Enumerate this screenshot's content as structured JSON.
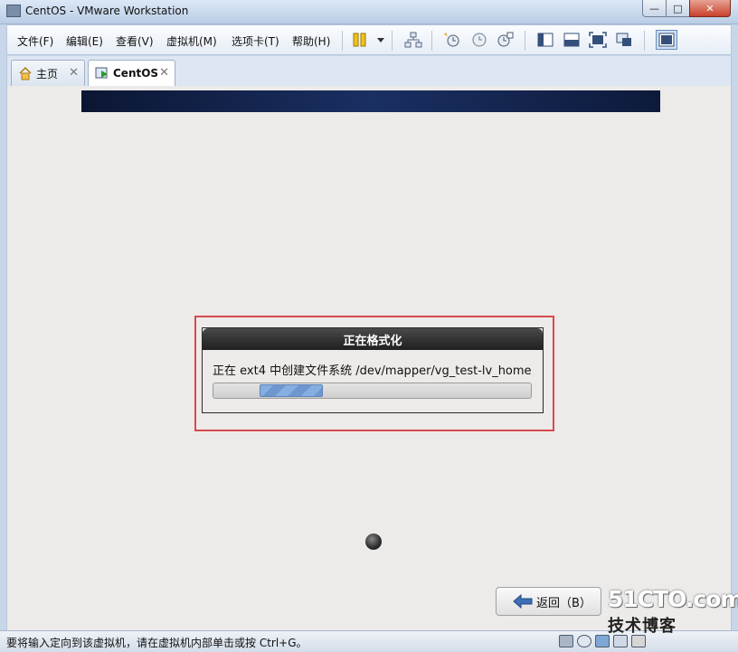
{
  "window": {
    "title": "CentOS - VMware Workstation",
    "minimize_glyph": "—",
    "maximize_glyph": "□",
    "close_glyph": "✕"
  },
  "menu": {
    "items": [
      "文件(F)",
      "编辑(E)",
      "查看(V)",
      "虚拟机(M)",
      "选项卡(T)",
      "帮助(H)"
    ]
  },
  "toolbar": {
    "icons": [
      "pause-icon",
      "dropdown-icon",
      "network-icon",
      "snapshot-take-icon",
      "snapshot-revert-icon",
      "snapshot-manager-icon",
      "sidebar-icon",
      "console-view-icon",
      "fullscreen-icon",
      "unity-icon",
      "library-icon"
    ]
  },
  "tabs": [
    {
      "label": "主页",
      "icon": "home-icon",
      "close": "✕"
    },
    {
      "label": "CentOS",
      "icon": "vm-running-icon",
      "close": "✕"
    }
  ],
  "dialog": {
    "title": "正在格式化",
    "message": "正在 ext4 中创建文件系统 /dev/mapper/vg_test-lv_home",
    "progress_fraction": 0.2
  },
  "buttons": {
    "back_label": "返回（B）"
  },
  "status": {
    "message": "要将输入定向到该虚拟机，请在虚拟机内部单击或按 Ctrl+G。"
  },
  "watermark": {
    "line1": "51CTO.com",
    "line2": "技术博客"
  },
  "colors": {
    "highlight_border": "#d54b4b",
    "banner": "#0c1633",
    "progress_fill": "#86aee0"
  }
}
